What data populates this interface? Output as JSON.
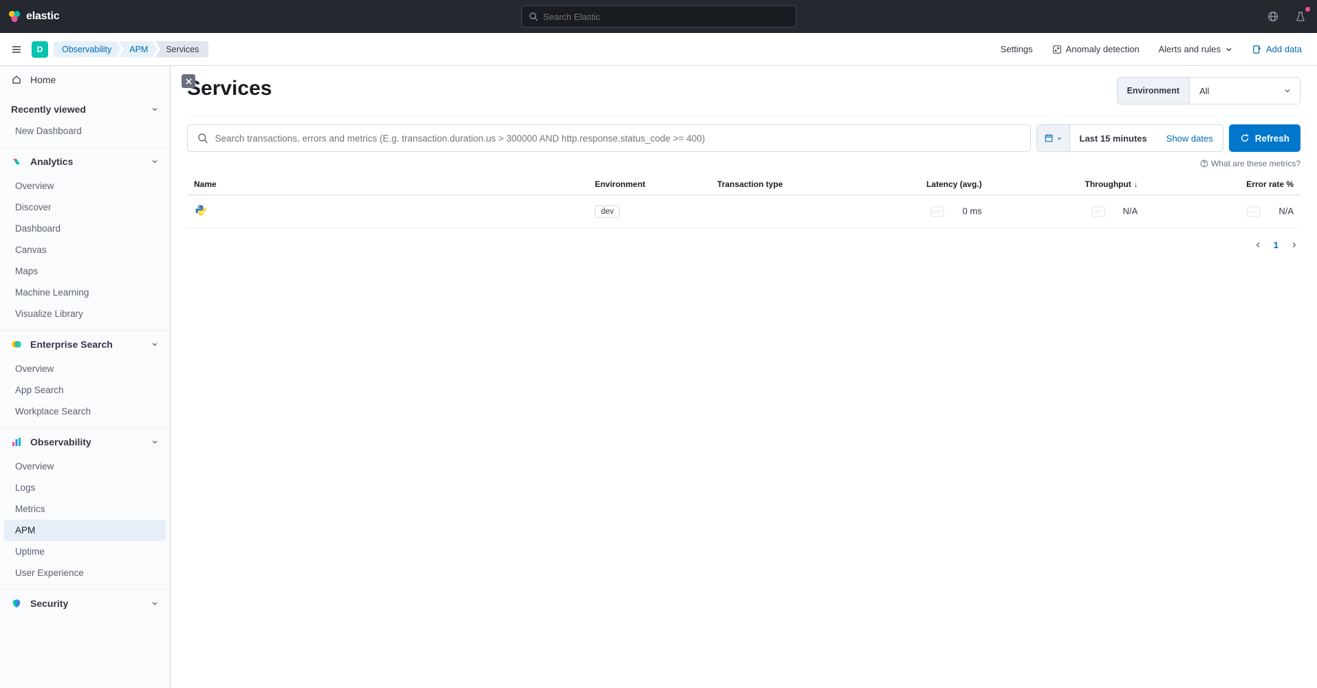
{
  "header": {
    "brand": "elastic",
    "searchPlaceholder": "Search Elastic"
  },
  "spaceLetter": "D",
  "breadcrumbs": [
    "Observability",
    "APM",
    "Services"
  ],
  "secondaryNav": {
    "settings": "Settings",
    "anomalyDetection": "Anomaly detection",
    "alertsRules": "Alerts and rules",
    "addData": "Add data"
  },
  "sidebar": {
    "home": "Home",
    "recentlyViewed": "Recently viewed",
    "recentItems": [
      "New Dashboard"
    ],
    "groups": [
      {
        "name": "Analytics",
        "items": [
          "Overview",
          "Discover",
          "Dashboard",
          "Canvas",
          "Maps",
          "Machine Learning",
          "Visualize Library"
        ],
        "active": null
      },
      {
        "name": "Enterprise Search",
        "items": [
          "Overview",
          "App Search",
          "Workplace Search"
        ],
        "active": null
      },
      {
        "name": "Observability",
        "items": [
          "Overview",
          "Logs",
          "Metrics",
          "APM",
          "Uptime",
          "User Experience"
        ],
        "active": "APM"
      },
      {
        "name": "Security",
        "items": [],
        "active": null
      }
    ]
  },
  "page": {
    "title": "Services",
    "environmentLabel": "Environment",
    "environmentValue": "All",
    "searchPlaceholder": "Search transactions, errors and metrics (E.g. transaction.duration.us > 300000 AND http.response.status_code >= 400)",
    "datePicker": "Last 15 minutes",
    "showDates": "Show dates",
    "refresh": "Refresh",
    "metricsHelp": "What are these metrics?"
  },
  "table": {
    "columns": {
      "name": "Name",
      "environment": "Environment",
      "transactionType": "Transaction type",
      "latency": "Latency (avg.)",
      "throughput": "Throughput",
      "errorRate": "Error rate %"
    },
    "rows": [
      {
        "environment": "dev",
        "latency": "0 ms",
        "throughput": "N/A",
        "errorRate": "N/A"
      }
    ]
  },
  "pagination": {
    "current": "1"
  }
}
